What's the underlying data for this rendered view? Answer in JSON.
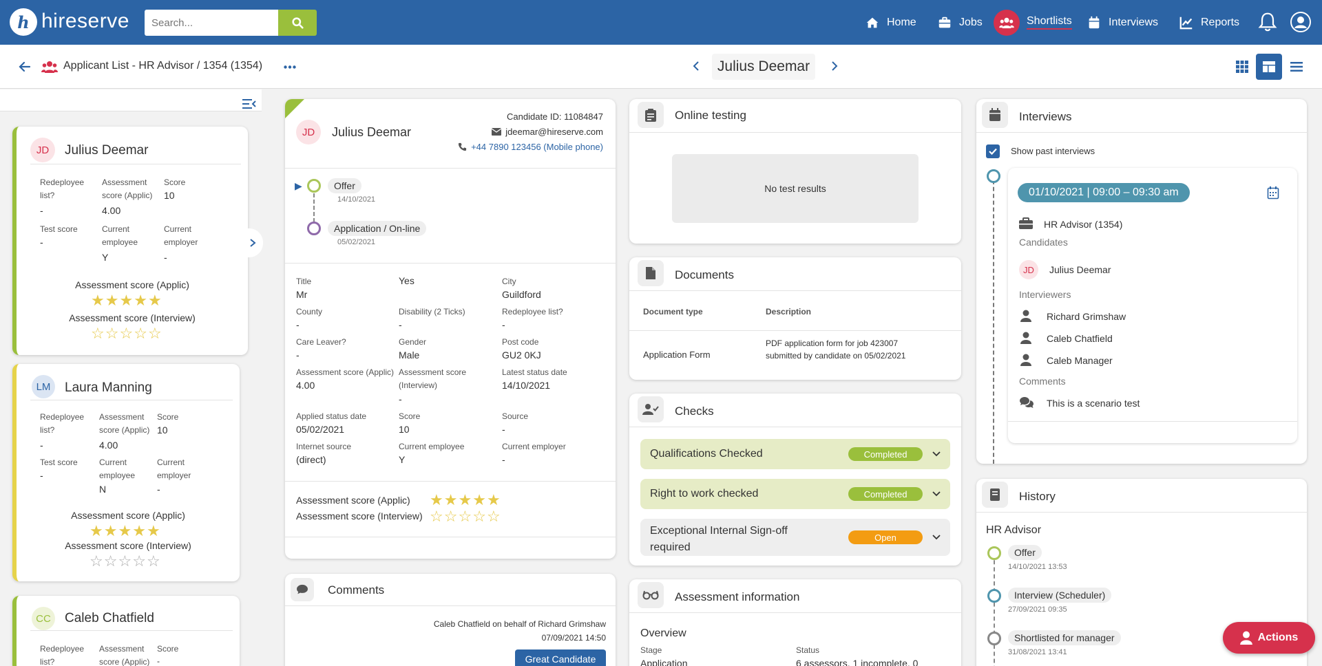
{
  "topbar": {
    "logo_letter": "h",
    "brand": "hireserve",
    "search_placeholder": "Search...",
    "nav": [
      {
        "label": "Home",
        "icon": "home-icon"
      },
      {
        "label": "Jobs",
        "icon": "briefcase-icon"
      },
      {
        "label": "Shortlists",
        "icon": "users-icon",
        "active": true
      },
      {
        "label": "Interviews",
        "icon": "calendar-icon"
      },
      {
        "label": "Reports",
        "icon": "chart-icon"
      }
    ],
    "colors": {
      "bar": "#2c64a5",
      "search_button": "#9abf3c",
      "active": "#d6314c"
    }
  },
  "subbar": {
    "breadcrumb": "Applicant List - HR Advisor / 1354 (1354)",
    "candidate_name": "Julius Deemar"
  },
  "list": {
    "cards": [
      {
        "initials": "JD",
        "name": "Julius Deemar",
        "f1_label": "Redeployee list?",
        "f1_value": "-",
        "f2_label": "Assessment score (Applic)",
        "f2_value": "4.00",
        "f3_label": "Score",
        "f3_value": "10",
        "f4_label": "Test score",
        "f4_value": "-",
        "f5_label": "Current employee",
        "f5_value": "Y",
        "f6_label": "Current employer",
        "f6_value": "-",
        "applic_label": "Assessment score (Applic)",
        "applic_stars": 5,
        "interview_label": "Assessment score (Interview)",
        "interview_stars": 0
      },
      {
        "initials": "LM",
        "name": "Laura Manning",
        "f1_label": "Redeployee list?",
        "f1_value": "-",
        "f2_label": "Assessment score (Applic)",
        "f2_value": "4.00",
        "f3_label": "Score",
        "f3_value": "10",
        "f4_label": "Test score",
        "f4_value": "-",
        "f5_label": "Current employee",
        "f5_value": "N",
        "f6_label": "Current employer",
        "f6_value": "-",
        "applic_label": "Assessment score (Applic)",
        "applic_stars": 5,
        "interview_label": "Assessment score (Interview)",
        "interview_stars": 0
      },
      {
        "initials": "CC",
        "name": "Caleb Chatfield",
        "f1_label": "Redeployee list?",
        "f2_label": "Assessment score (Applic)",
        "f3_label": "Score",
        "f3_value": "-"
      }
    ]
  },
  "candidate": {
    "initials": "JD",
    "name": "Julius Deemar",
    "candidate_id": "Candidate ID: 11084847",
    "email": "jdeemar@hireserve.com",
    "phone": "+44 7890 123456 (Mobile phone)",
    "timeline": [
      {
        "label": "Offer",
        "date": "14/10/2021"
      },
      {
        "label": "Application / On-line",
        "date": "05/02/2021"
      }
    ],
    "fields": [
      {
        "label": "Title",
        "value": "Mr"
      },
      {
        "label": "",
        "value": "Yes"
      },
      {
        "label": "City",
        "value": "Guildford"
      },
      {
        "label": "County",
        "value": "-"
      },
      {
        "label": "Disability (2 Ticks)",
        "value": "-"
      },
      {
        "label": "Redeployee list?",
        "value": "-"
      },
      {
        "label": "Care Leaver?",
        "value": "-"
      },
      {
        "label": "Gender",
        "value": "Male"
      },
      {
        "label": "Post code",
        "value": "GU2 0KJ"
      },
      {
        "label": "Assessment score (Applic)",
        "value": "4.00"
      },
      {
        "label": "Assessment score (Interview)",
        "value": "-"
      },
      {
        "label": "Latest status date",
        "value": "14/10/2021"
      },
      {
        "label": "Applied status date",
        "value": "05/02/2021"
      },
      {
        "label": "Score",
        "value": "10"
      },
      {
        "label": "Source",
        "value": "-"
      },
      {
        "label": "Internet source",
        "value": "(direct)"
      },
      {
        "label": "Current employee",
        "value": "Y"
      },
      {
        "label": "Current employer",
        "value": "-"
      }
    ],
    "applic_label": "Assessment score (Applic)",
    "applic_stars": 5,
    "interview_label": "Assessment score (Interview)",
    "interview_stars": 0
  },
  "comments": {
    "title": "Comments",
    "author": "Caleb Chatfield on behalf of Richard Grimshaw",
    "timestamp": "07/09/2021 14:50",
    "tag": "Great Candidate"
  },
  "online_testing": {
    "title": "Online testing",
    "empty": "No test results"
  },
  "documents": {
    "title": "Documents",
    "col_type": "Document type",
    "col_desc": "Description",
    "rows": [
      {
        "type": "Application Form",
        "description": "PDF application form for job 423007 submitted by candidate on 05/02/2021"
      }
    ]
  },
  "checks": {
    "title": "Checks",
    "items": [
      {
        "label": "Qualifications Checked",
        "status": "Completed",
        "color": "#9abf3c",
        "bg": "#e6ecc6"
      },
      {
        "label": "Right to work checked",
        "status": "Completed",
        "color": "#9abf3c",
        "bg": "#e6ecc6"
      },
      {
        "label": "Exceptional Internal Sign-off required",
        "status": "Open",
        "color": "#f39c12",
        "bg": "#eeeeee"
      }
    ]
  },
  "assessment": {
    "title": "Assessment information",
    "overview": "Overview",
    "stage_label": "Stage",
    "stage_value": "Application",
    "status_label": "Status",
    "status_value": "6 assessors, 1 incomplete, 0"
  },
  "interviews": {
    "title": "Interviews",
    "show_past": "Show past interviews",
    "slot": "01/10/2021 | 09:00 – 09:30 am",
    "job": "HR Advisor (1354)",
    "candidates_label": "Candidates",
    "candidate_initials": "JD",
    "candidate_name": "Julius Deemar",
    "interviewers_label": "Interviewers",
    "interviewers": [
      "Richard Grimshaw",
      "Caleb Chatfield",
      "Caleb Manager"
    ],
    "comments_label": "Comments",
    "comment": "This is a scenario test"
  },
  "history": {
    "title": "History",
    "job": "HR Advisor",
    "items": [
      {
        "label": "Offer",
        "date": "14/10/2021 13:53"
      },
      {
        "label": "Interview (Scheduler)",
        "date": "27/09/2021 09:35"
      },
      {
        "label": "Shortlisted for manager",
        "date": "31/08/2021 13:41"
      }
    ]
  },
  "actions": {
    "label": "Actions"
  }
}
